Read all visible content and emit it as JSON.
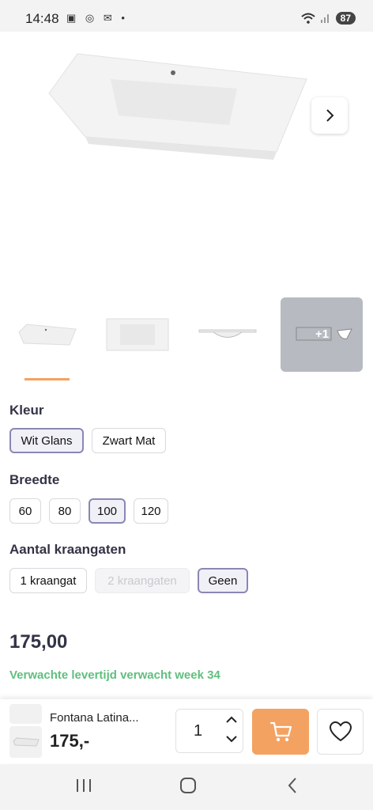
{
  "status": {
    "time": "14:48",
    "battery": "87"
  },
  "thumbs": {
    "more_label": "+1"
  },
  "options": {
    "kleur": {
      "label": "Kleur",
      "items": [
        "Wit Glans",
        "Zwart Mat"
      ],
      "selected": "Wit Glans"
    },
    "breedte": {
      "label": "Breedte",
      "items": [
        "60",
        "80",
        "100",
        "120"
      ],
      "selected": "100"
    },
    "kraangaten": {
      "label": "Aantal kraangaten",
      "items": [
        "1 kraangat",
        "2 kraangaten",
        "Geen"
      ],
      "selected": "Geen",
      "disabled": "2 kraangaten"
    }
  },
  "price": "175,00",
  "delivery": "Verwachte levertijd verwacht week 34",
  "bottom_bar": {
    "product_name": "Fontana Latina...",
    "price": "175,-",
    "quantity": "1"
  },
  "colors": {
    "accent": "#f4a261",
    "delivery": "#5fbf7d",
    "selected_border": "#8a87b5"
  }
}
